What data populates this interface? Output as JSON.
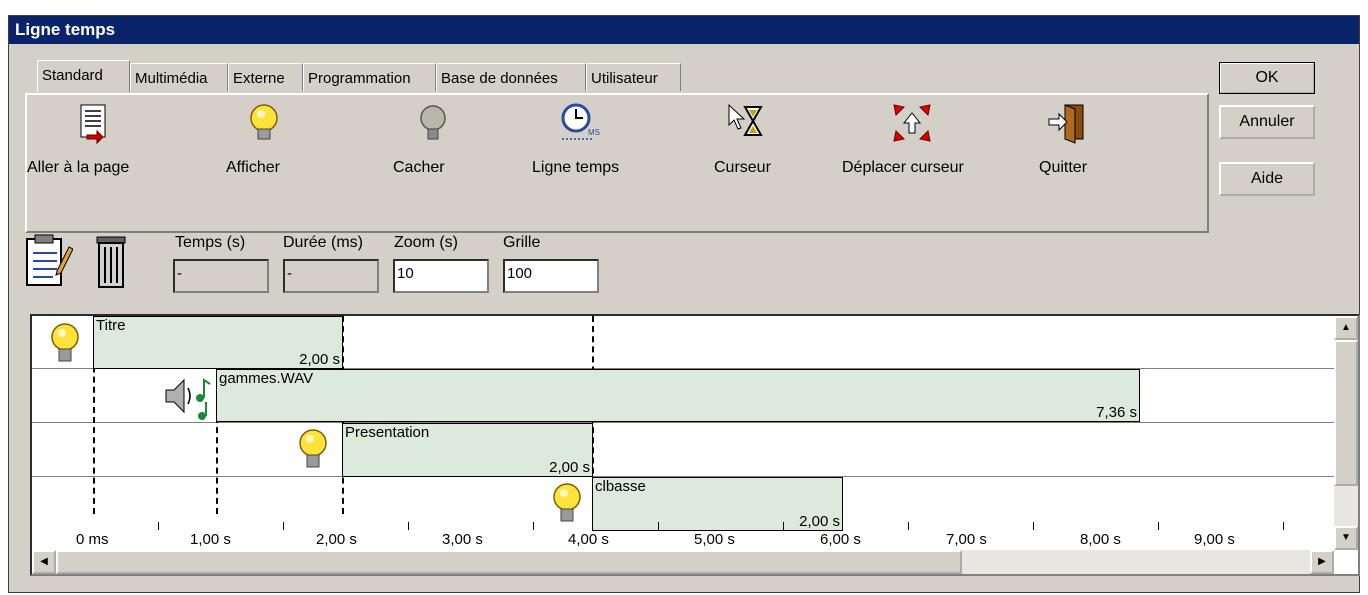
{
  "window": {
    "title": "Ligne temps"
  },
  "tabs": [
    "Standard",
    "Multimédia",
    "Externe",
    "Programmation",
    "Base de données",
    "Utilisateur"
  ],
  "tools": [
    {
      "label": "Aller à la page",
      "icon": "page-goto-icon"
    },
    {
      "label": "Afficher",
      "icon": "lightbulb-on-icon"
    },
    {
      "label": "Cacher",
      "icon": "lightbulb-off-icon"
    },
    {
      "label": "Ligne temps",
      "icon": "clock-icon"
    },
    {
      "label": "Curseur",
      "icon": "cursor-hourglass-icon"
    },
    {
      "label": "Déplacer curseur",
      "icon": "move-cursor-icon"
    },
    {
      "label": "Quitter",
      "icon": "exit-door-icon"
    }
  ],
  "buttons": {
    "ok": "OK",
    "cancel": "Annuler",
    "help": "Aide"
  },
  "fields": {
    "time_label": "Temps (s)",
    "time_value": "-",
    "duration_label": "Durée (ms)",
    "duration_value": "-",
    "zoom_label": "Zoom (s)",
    "zoom_value": "10",
    "grid_label": "Grille",
    "grid_value": "100"
  },
  "timeline": {
    "blocks": [
      {
        "name": "Titre",
        "duration": "2,00 s",
        "icon": "lightbulb-on-icon"
      },
      {
        "name": "gammes.WAV",
        "duration": "7,36 s",
        "icon": "speaker-music-icon"
      },
      {
        "name": "Presentation",
        "duration": "2,00 s",
        "icon": "lightbulb-on-icon"
      },
      {
        "name": "clbasse",
        "duration": "2,00 s",
        "icon": "lightbulb-on-icon"
      }
    ],
    "ticks": [
      "0 ms",
      "1,00 s",
      "2,00 s",
      "3,00 s",
      "4,00 s",
      "5,00 s",
      "6,00 s",
      "7,00 s",
      "8,00 s",
      "9,00 s"
    ]
  }
}
